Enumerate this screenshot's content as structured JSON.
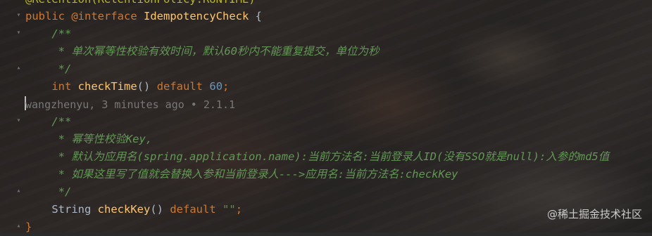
{
  "lines": {
    "l0": "@Retention(RetentionPolicy.RUNTIME)",
    "l1_kw": "public",
    "l1_ann": "@interface",
    "l1_name": "IdempotencyCheck",
    "l1_brace": " {",
    "l2": "/**",
    "l3": "* 单次幂等性校验有效时间，默认60秒内不能重复提交，单位为秒",
    "l4": "*/",
    "l5_type": "int",
    "l5_name": "checkTime",
    "l5_parens": "()",
    "l5_default": "default",
    "l5_value": "60",
    "l5_end": ";",
    "blame": "wangzhenyu, 3 minutes ago • 2.1.1",
    "l7": "/**",
    "l8": "* 幂等性校验Key,",
    "l9": "* 默认为应用名(spring.application.name):当前方法名:当前登录人ID(没有SSO就是null):入参的md5值",
    "l10": "* 如果这里写了值就会替换入参和当前登录人--->应用名:当前方法名:checkKey",
    "l11": "*/",
    "l12_type": "String",
    "l12_name": "checkKey",
    "l12_parens": "()",
    "l12_default": "default",
    "l12_value": "\"\"",
    "l12_end": ";",
    "l13": "}"
  },
  "watermark": "@稀土掘金技术社区",
  "icons": [
    "fold-icon",
    "caret-icon"
  ]
}
